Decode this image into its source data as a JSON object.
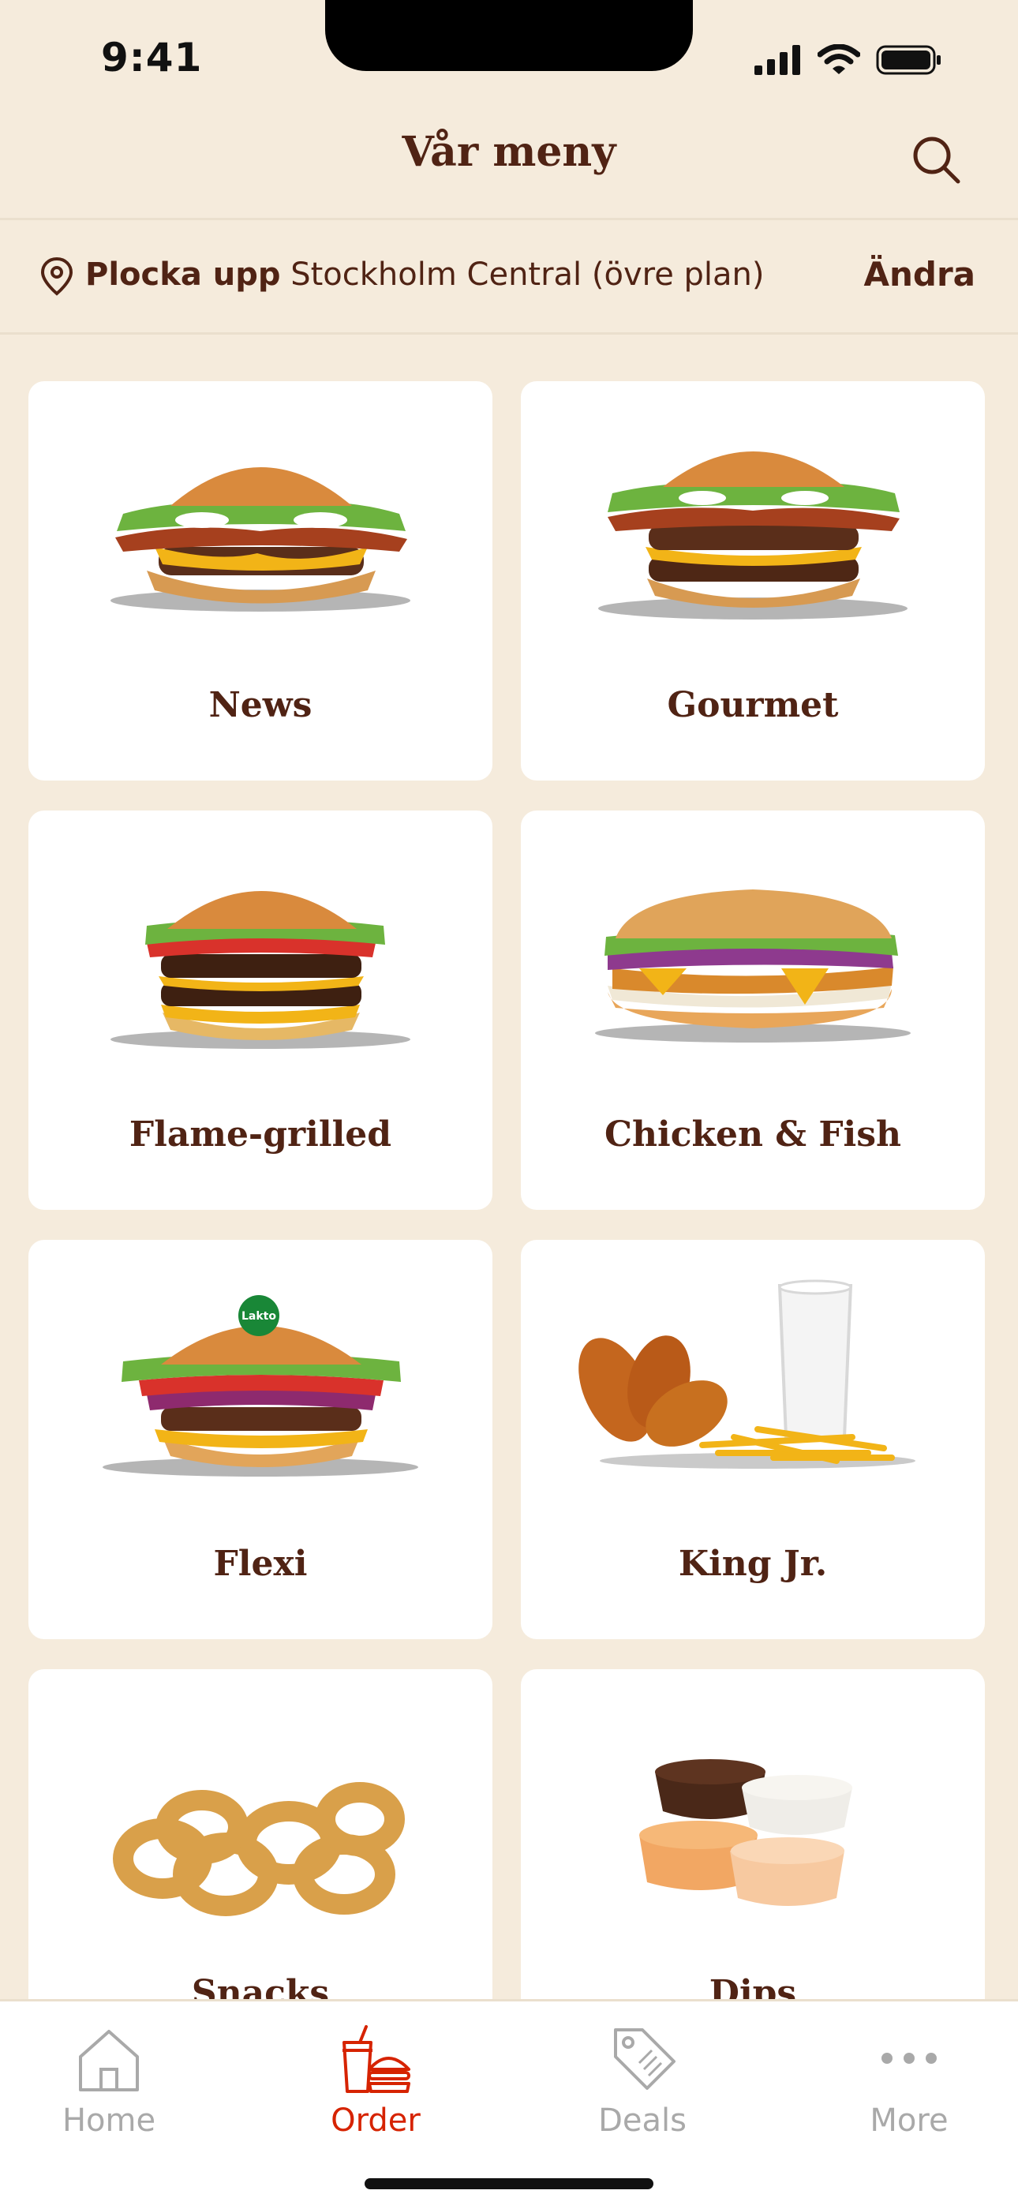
{
  "status_bar": {
    "time": "9:41"
  },
  "header": {
    "title": "Vår meny",
    "search_icon": "search-icon"
  },
  "pickup": {
    "icon": "location-pin-icon",
    "label": "Plocka upp",
    "location": "Stockholm Central (övre plan)",
    "change_label": "Ändra"
  },
  "menu": {
    "categories": [
      {
        "label": "News",
        "art": "burger-bacon-icon"
      },
      {
        "label": "Gourmet",
        "art": "burger-double-bacon-icon"
      },
      {
        "label": "Flame-grilled",
        "art": "burger-double-cheese-icon"
      },
      {
        "label": "Chicken & Fish",
        "art": "chicken-sub-icon"
      },
      {
        "label": "Flexi",
        "art": "veggie-burger-icon",
        "badge": "Lakto"
      },
      {
        "label": "King Jr.",
        "art": "kids-meal-icon"
      },
      {
        "label": "Snacks",
        "art": "onion-rings-icon"
      },
      {
        "label": "Dips",
        "art": "dip-cups-icon"
      }
    ]
  },
  "bottom_nav": {
    "items": [
      {
        "label": "Home",
        "icon": "home-icon",
        "active": false
      },
      {
        "label": "Order",
        "icon": "order-icon",
        "active": true
      },
      {
        "label": "Deals",
        "icon": "deals-tag-icon",
        "active": false
      },
      {
        "label": "More",
        "icon": "more-dots-icon",
        "active": false
      }
    ]
  },
  "colors": {
    "background": "#F5EBDC",
    "brand_brown": "#502314",
    "brand_red": "#D62300",
    "inactive_gray": "#A9A9A9",
    "badge_green": "#198737"
  }
}
